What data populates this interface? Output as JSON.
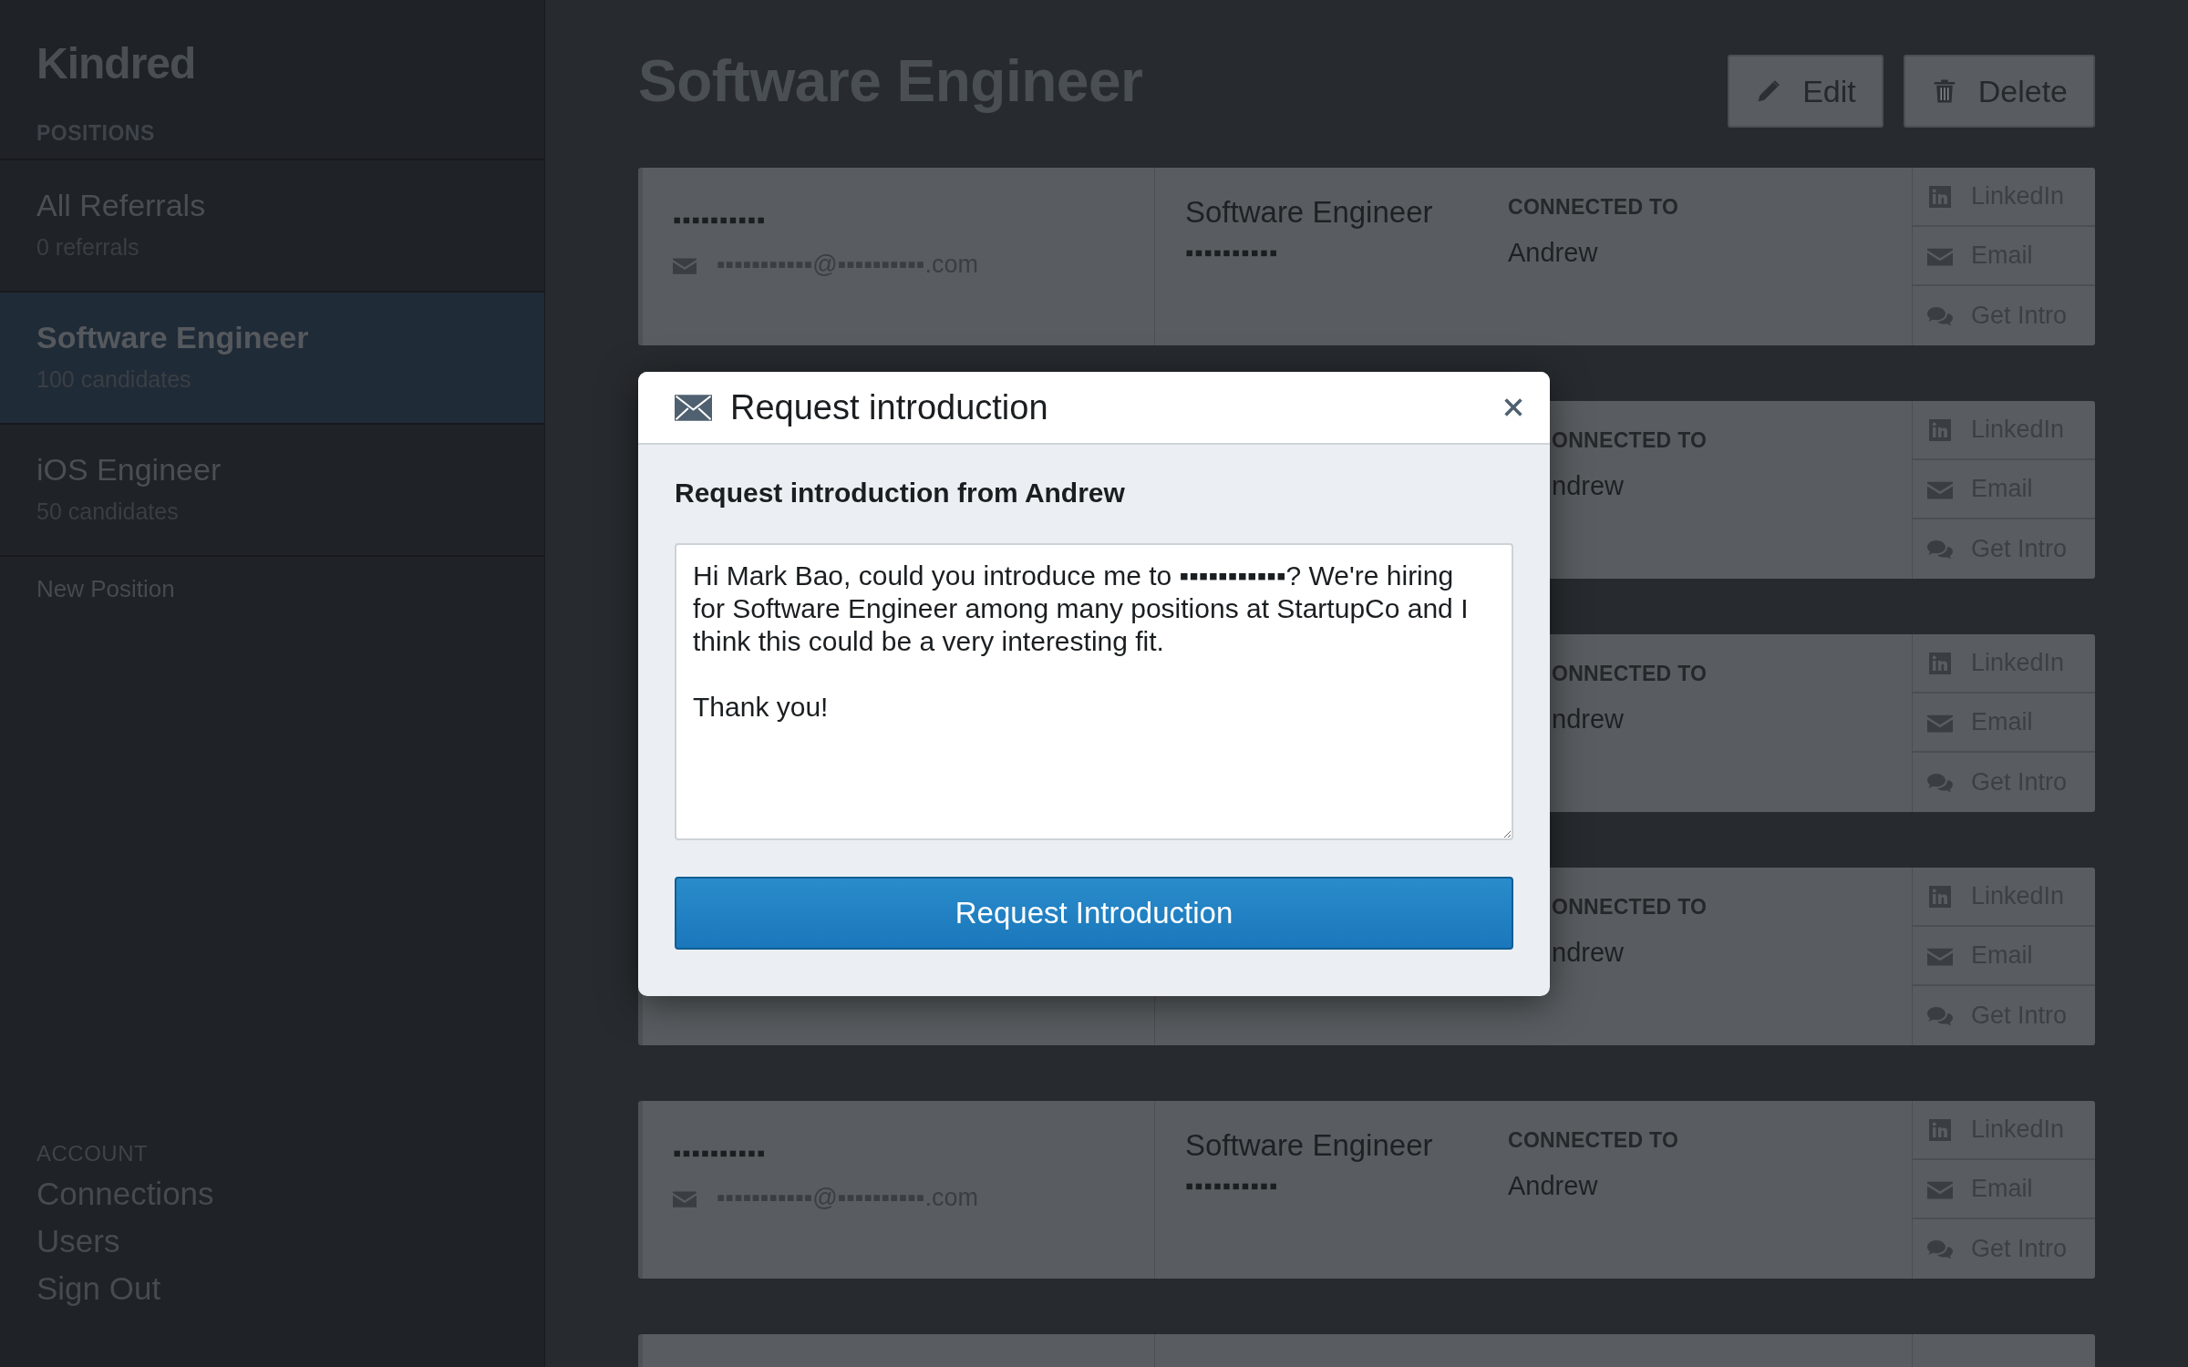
{
  "sidebar": {
    "brand": "Kindred",
    "positions_heading": "POSITIONS",
    "positions": [
      {
        "title": "All Referrals",
        "subtitle": "0 referrals",
        "selected": false
      },
      {
        "title": "Software Engineer",
        "subtitle": "100 candidates",
        "selected": true
      },
      {
        "title": "iOS Engineer",
        "subtitle": "50 candidates",
        "selected": false
      }
    ],
    "new_position": "New Position",
    "account_heading": "ACCOUNT",
    "account_links": [
      "Connections",
      "Users",
      "Sign Out"
    ]
  },
  "header": {
    "title": "Software Engineer",
    "buttons": [
      {
        "label": "Edit",
        "kind": "edit"
      },
      {
        "label": "Delete",
        "kind": "delete"
      }
    ]
  },
  "candidates": [
    {
      "kind": "full",
      "name": "▪▪▪▪▪▪▪▪▪▪",
      "email": "▪▪▪▪▪▪▪▪▪▪▪@▪▪▪▪▪▪▪▪▪▪.com",
      "position": "Software Engineer",
      "position_detail": "▪▪▪▪▪▪▪▪▪▪",
      "connected_label": "CONNECTED TO",
      "connected_name": "Andrew",
      "actions": [
        {
          "label": "LinkedIn",
          "kind": "linkedin"
        },
        {
          "label": "Email",
          "kind": "email"
        },
        {
          "label": "Get Intro",
          "kind": "intro"
        }
      ]
    },
    {
      "kind": "covered",
      "connected_label": "ONNECTED TO",
      "connected_name": "ndrew",
      "actions": [
        {
          "label": "LinkedIn",
          "kind": "linkedin"
        },
        {
          "label": "Email",
          "kind": "email"
        },
        {
          "label": "Get Intro",
          "kind": "intro"
        }
      ]
    },
    {
      "kind": "covered",
      "connected_label": "ONNECTED TO",
      "connected_name": "ndrew",
      "actions": [
        {
          "label": "LinkedIn",
          "kind": "linkedin"
        },
        {
          "label": "Email",
          "kind": "email"
        },
        {
          "label": "Get Intro",
          "kind": "intro"
        }
      ]
    },
    {
      "kind": "covered",
      "connected_label": "ONNECTED TO",
      "connected_name": "ndrew",
      "actions": [
        {
          "label": "LinkedIn",
          "kind": "linkedin"
        },
        {
          "label": "Email",
          "kind": "email"
        },
        {
          "label": "Get Intro",
          "kind": "intro"
        }
      ]
    },
    {
      "kind": "full",
      "name": "▪▪▪▪▪▪▪▪▪▪",
      "email": "▪▪▪▪▪▪▪▪▪▪▪@▪▪▪▪▪▪▪▪▪▪.com",
      "position": "Software Engineer",
      "position_detail": "▪▪▪▪▪▪▪▪▪▪",
      "connected_label": "CONNECTED TO",
      "connected_name": "Andrew",
      "actions": [
        {
          "label": "LinkedIn",
          "kind": "linkedin"
        },
        {
          "label": "Email",
          "kind": "email"
        },
        {
          "label": "Get Intro",
          "kind": "intro"
        }
      ]
    },
    {
      "kind": "cut"
    }
  ],
  "modal": {
    "title": "Request introduction",
    "subtitle": "Request introduction from Andrew",
    "message": "Hi Mark Bao, could you introduce me to ▪▪▪▪▪▪▪▪▪▪▪? We're hiring for Software Engineer among many positions at StartupCo and I think this could be a very interesting fit.\n\nThank you!",
    "submit": "Request Introduction"
  }
}
